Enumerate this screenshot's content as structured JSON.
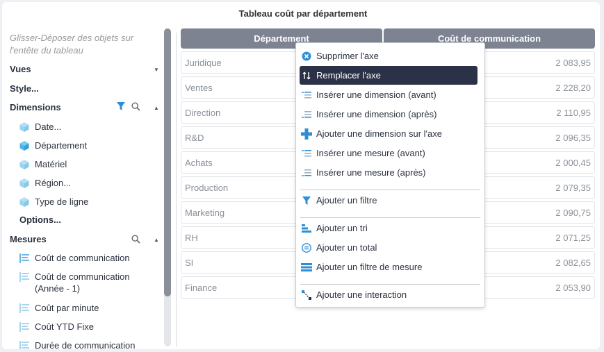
{
  "title": "Tableau coût par département",
  "sidebar": {
    "hint": "Glisser-Déposer des objets sur l'entête du tableau",
    "vues": "Vues",
    "style": "Style...",
    "dimensions": {
      "label": "Dimensions",
      "items": [
        "Date...",
        "Département",
        "Matériel",
        "Région...",
        "Type de ligne"
      ],
      "options": "Options..."
    },
    "mesures": {
      "label": "Mesures",
      "items": [
        "Coût de communication",
        "Coût de communication (Année - 1)",
        "Coût par minute",
        "Coût YTD Fixe",
        "Durée de communication"
      ]
    }
  },
  "table": {
    "headers": [
      "Département",
      "Coût de communication"
    ],
    "rows": [
      {
        "dep": "Juridique",
        "val": "2 083,95"
      },
      {
        "dep": "Ventes",
        "val": "2 228,20"
      },
      {
        "dep": "Direction",
        "val": "2 110,95"
      },
      {
        "dep": "R&D",
        "val": "2 096,35"
      },
      {
        "dep": "Achats",
        "val": "2 000,45"
      },
      {
        "dep": "Production",
        "val": "2 079,35"
      },
      {
        "dep": "Marketing",
        "val": "2 090,75"
      },
      {
        "dep": "RH",
        "val": "2 071,25"
      },
      {
        "dep": "SI",
        "val": "2 082,65"
      },
      {
        "dep": "Finance",
        "val": "2 053,90"
      }
    ]
  },
  "menu": {
    "items": [
      {
        "label": "Supprimer l'axe",
        "icon": "remove-circle-icon"
      },
      {
        "label": "Remplacer l'axe",
        "icon": "swap-icon",
        "active": true
      },
      {
        "label": "Insérer une dimension (avant)",
        "icon": "insert-before-icon"
      },
      {
        "label": "Insérer une dimension (après)",
        "icon": "insert-after-icon"
      },
      {
        "label": "Ajouter une dimension sur l'axe",
        "icon": "plus-icon"
      },
      {
        "label": "Insérer une mesure (avant)",
        "icon": "insert-before-icon"
      },
      {
        "label": "Insérer une mesure (après)",
        "icon": "insert-after-icon"
      },
      {
        "label": "Ajouter un filtre",
        "icon": "filter-icon"
      },
      {
        "label": "Ajouter un tri",
        "icon": "sort-icon"
      },
      {
        "label": "Ajouter un total",
        "icon": "total-icon"
      },
      {
        "label": "Ajouter un filtre de mesure",
        "icon": "measure-filter-icon"
      },
      {
        "label": "Ajouter une interaction",
        "icon": "interaction-icon"
      }
    ]
  },
  "colors": {
    "header": "#7d8391",
    "menu_active": "#2b3146",
    "accent": "#2e8fd6",
    "dim_icon": "#7ac5e8"
  }
}
